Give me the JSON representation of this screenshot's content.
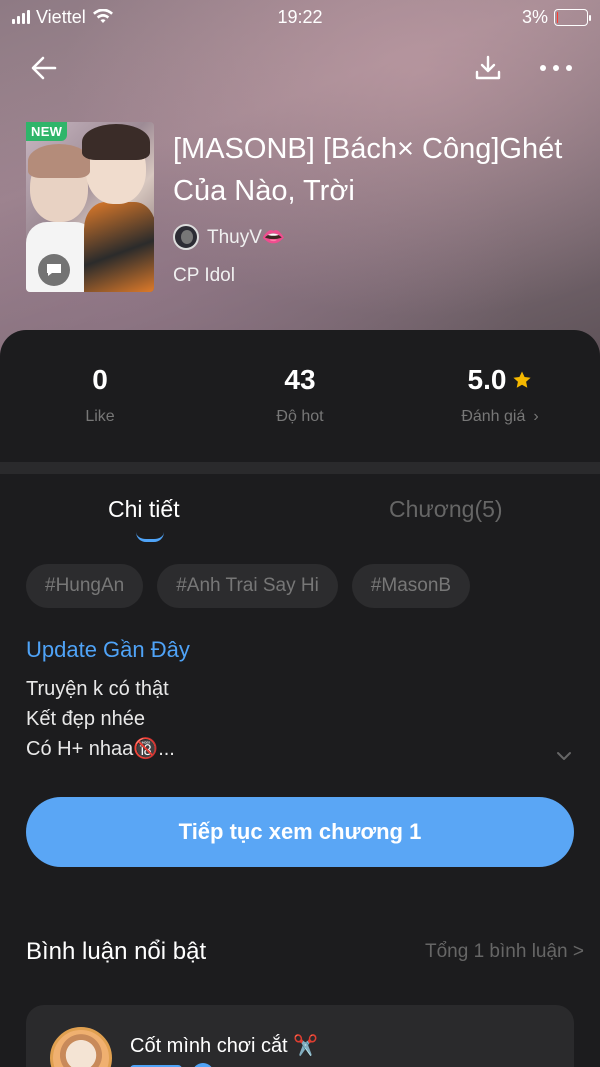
{
  "status_bar": {
    "carrier": "Viettel",
    "time": "19:22",
    "battery_percent": "3%",
    "battery_level": 0.03,
    "battery_color": "#ff3b30"
  },
  "nav": {
    "back_icon": "arrow-left-icon",
    "download_icon": "download-icon",
    "more_icon": "more-horizontal-icon"
  },
  "story": {
    "badge": "NEW",
    "title": "[MASONB] [Bách× Công]Ghét Của Nào, Trời",
    "author": "ThuyV👄",
    "category": "CP Idol"
  },
  "stats": {
    "likes": {
      "value": "0",
      "label": "Like"
    },
    "hot": {
      "value": "43",
      "label": "Độ hot"
    },
    "rating": {
      "value": "5.0",
      "label": "Đánh giá",
      "chevron": "›"
    }
  },
  "tabs": {
    "details": "Chi tiết",
    "chapters": "Chương(5)"
  },
  "tags": [
    "#HungAn",
    "#Anh Trai Say Hi",
    "#MasonB"
  ],
  "update": {
    "title": "Update Gần Đây",
    "lines": [
      "Truyện k có thật",
      "Kết đẹp nhée",
      "Có H+ nhaa🔞..."
    ]
  },
  "cta": {
    "label": "Tiếp tục xem chương 1"
  },
  "comments": {
    "title": "Bình luận nổi bật",
    "total": "Tổng 1 bình luận >",
    "items": [
      {
        "name": "Cốt mình chơi cắt ✂️"
      }
    ]
  },
  "colors": {
    "accent": "#4fa3f7",
    "button": "#5aa6f5",
    "new_badge": "#2fb56a",
    "star": "#f5b800",
    "panel": "#1c1c1e"
  }
}
